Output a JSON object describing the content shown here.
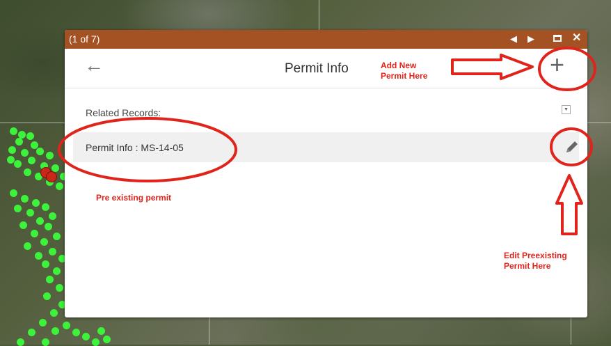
{
  "popup": {
    "counter": "(1 of 7)",
    "title": "Permit Info",
    "related_label": "Related Records:",
    "record_label": "Permit Info : MS-14-05"
  },
  "icons": {
    "prev": "◀",
    "next": "▶",
    "close": "✕",
    "back": "←",
    "add": "+",
    "dropdown": "▼"
  },
  "annotations": {
    "add_line1": "Add New",
    "add_line2": "Permit Here",
    "existing": "Pre existing permit",
    "edit_line1": "Edit Preexisting",
    "edit_line2": "Permit Here"
  },
  "colors": {
    "titlebar": "#a45223",
    "annotation": "#e0241b",
    "feature_dot": "#3df23a"
  }
}
